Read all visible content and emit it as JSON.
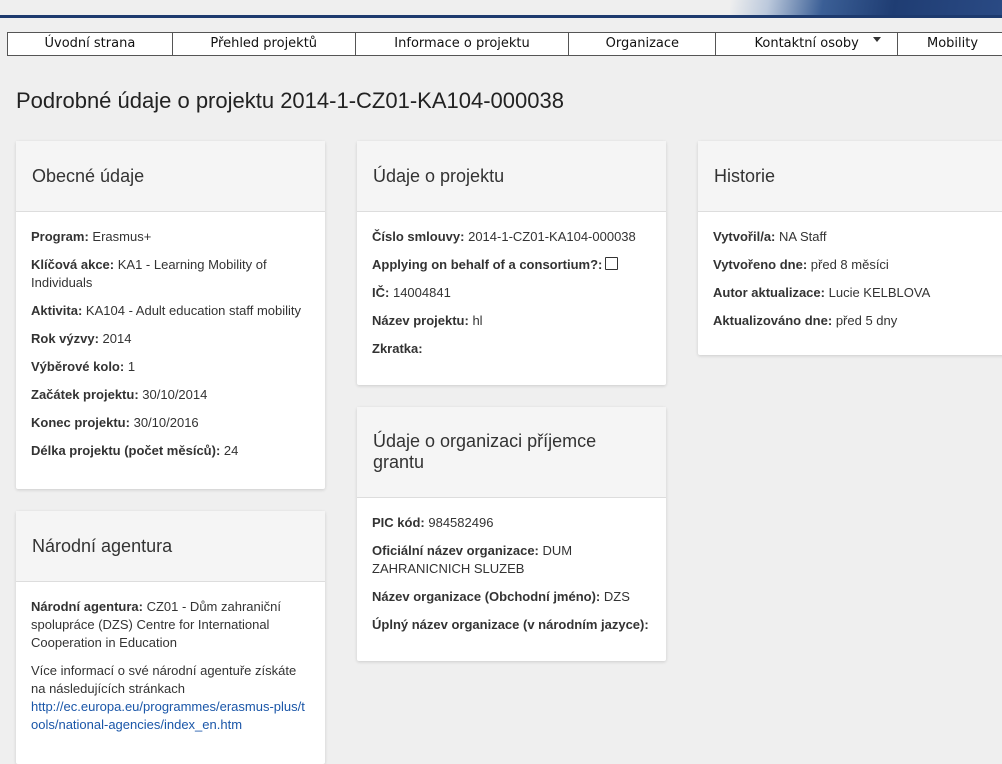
{
  "nav": {
    "items": [
      {
        "label": "Úvodní strana"
      },
      {
        "label": "Přehled projektů"
      },
      {
        "label": "Informace o projektu"
      },
      {
        "label": "Organizace"
      },
      {
        "label": "Kontaktní osoby"
      },
      {
        "label": "Mobility"
      }
    ]
  },
  "page_title": "Podrobné údaje o projektu 2014-1-CZ01-KA104-000038",
  "general": {
    "title": "Obecné údaje",
    "program_label": "Program:",
    "program_value": "Erasmus+",
    "key_action_label": "Klíčová akce:",
    "key_action_value": "KA1 - Learning Mobility of Individuals",
    "activity_label": "Aktivita:",
    "activity_value": "KA104 - Adult education staff mobility",
    "call_year_label": "Rok výzvy:",
    "call_year_value": "2014",
    "round_label": "Výběrové kolo:",
    "round_value": "1",
    "start_label": "Začátek projektu:",
    "start_value": "30/10/2014",
    "end_label": "Konec projektu:",
    "end_value": "30/10/2016",
    "duration_label": "Délka projektu (počet měsíců):",
    "duration_value": "24"
  },
  "agency": {
    "title": "Národní agentura",
    "label": "Národní agentura:",
    "value": "CZ01 - Dům zahraniční spolupráce (DZS) Centre for International Cooperation in Education",
    "more_info": "Více informací o své národní agentuře získáte na následujících stránkach",
    "link": "http://ec.europa.eu/programmes/erasmus-plus/tools/national-agencies/index_en.htm"
  },
  "project": {
    "title": "Údaje o projektu",
    "contract_label": "Číslo smlouvy:",
    "contract_value": "2014-1-CZ01-KA104-000038",
    "consortium_label": "Applying on behalf of a consortium?:",
    "consortium_checked": false,
    "ic_label": "IČ:",
    "ic_value": "14004841",
    "name_label": "Název projektu:",
    "name_value": "hl",
    "abbr_label": "Zkratka:",
    "abbr_value": ""
  },
  "beneficiary": {
    "title": "Údaje o organizaci příjemce grantu",
    "pic_label": "PIC kód:",
    "pic_value": "984582496",
    "official_label": "Oficiální název organizace:",
    "official_value": "DUM ZAHRANICNICH SLUZEB",
    "business_label": "Název organizace (Obchodní jméno):",
    "business_value": "DZS",
    "full_label": "Úplný název organizace (v národním jazyce):",
    "full_value": ""
  },
  "history": {
    "title": "Historie",
    "created_by_label": "Vytvořil/a:",
    "created_by_value": "NA Staff",
    "created_label": "Vytvořeno dne:",
    "created_value": "před 8 měsíci",
    "updated_by_label": "Autor aktualizace:",
    "updated_by_value": "Lucie KELBLOVA",
    "updated_label": "Aktualizováno dne:",
    "updated_value": "před 5 dny"
  }
}
